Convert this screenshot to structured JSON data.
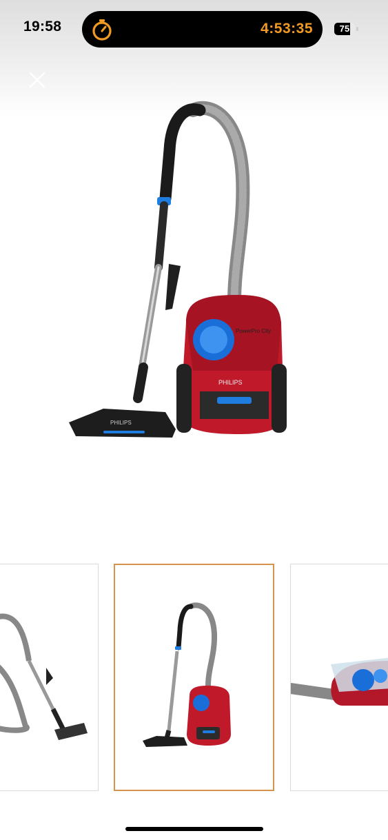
{
  "status_bar": {
    "time": "19:58",
    "timer": "4:53:35",
    "battery_level": "75",
    "battery_fraction": 0.75,
    "timer_color": "#f19a23"
  },
  "viewer": {
    "close_icon": "close-icon",
    "main_image": "vacuum-cleaner-front-view",
    "brand_text": "PHILIPS",
    "canister_label": "PowerPro City"
  },
  "thumbnails": [
    {
      "name": "vacuum-hose-and-wand-view",
      "selected": false
    },
    {
      "name": "vacuum-cleaner-front-view",
      "selected": true
    },
    {
      "name": "vacuum-canister-side-view",
      "selected": false
    }
  ],
  "colors": {
    "accent_selected": "#d7924c",
    "body_red": "#c0192a",
    "filter_blue": "#1a6ed8"
  }
}
